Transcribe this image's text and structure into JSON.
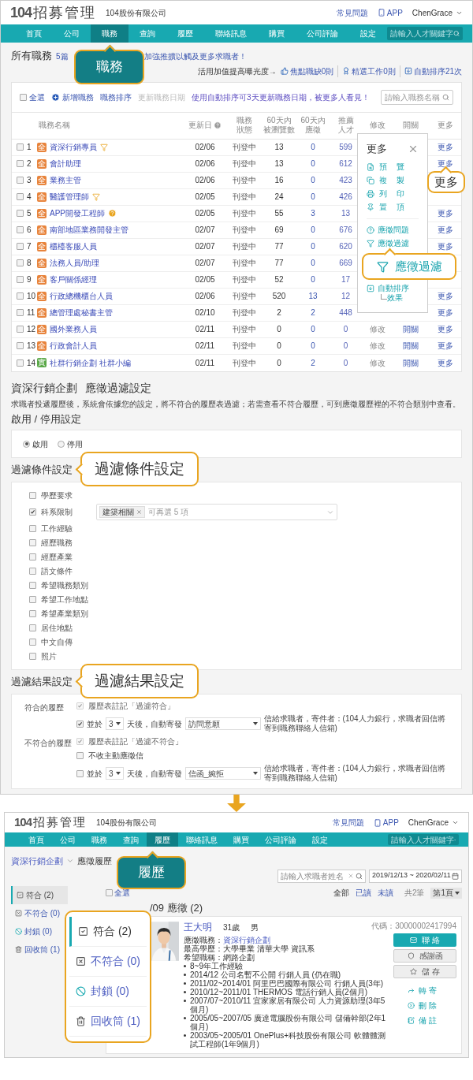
{
  "top": {
    "header": {
      "logo_digits": "104",
      "logo_text": "招募管理",
      "company": "104股份有限公司",
      "help": "常見問題",
      "app": "APP",
      "user": "ChenGrace"
    },
    "nav": {
      "items": [
        {
          "label": "首頁",
          "selected": false
        },
        {
          "label": "公司",
          "selected": false
        },
        {
          "label": "職務",
          "selected": true
        },
        {
          "label": "查詢",
          "selected": false
        },
        {
          "label": "履歷",
          "selected": false
        },
        {
          "label": "聯絡訊息",
          "selected": false
        },
        {
          "label": "購買",
          "selected": false
        },
        {
          "label": "公司評論",
          "selected": false
        },
        {
          "label": "設定",
          "selected": false
        }
      ],
      "search_placeholder": "請輸入人才關鍵字"
    },
    "callout": "職務",
    "title": "所有職務",
    "notice_start": "5篇",
    "notice_end": "加強推擴以觸及更多求職者！",
    "promo": {
      "label": "活用加值提高曝光度→",
      "items": [
        "焦點職缺0則",
        "精選工作0則",
        "自動排序21次"
      ]
    },
    "toolbar": {
      "select_all": "全選",
      "select_all_checked": false,
      "actions": [
        {
          "label": "新增職務",
          "disabled": false
        },
        {
          "label": "職務排序",
          "disabled": false
        },
        {
          "label": "更新職務日期",
          "disabled": true
        }
      ],
      "tip": "使用自動排序可3天更新職務日期，被更多人看見！",
      "search_placeholder": "請輸入職務名稱"
    },
    "columns": [
      "職務名稱",
      "更新日",
      "職務狀態",
      "60天內被瀏覽數",
      "60天內應徵",
      "推薦人才",
      "修改",
      "開關",
      "更多"
    ],
    "rows": [
      {
        "checked": false,
        "no": "1",
        "badge": "全",
        "color": "#e8843c",
        "name": "資深行銷專員",
        "filter": true,
        "questions": false,
        "date": "02/06",
        "status": "刊登中",
        "views": "13",
        "applies": "0",
        "talents": "599",
        "more": "更多"
      },
      {
        "checked": false,
        "no": "2",
        "badge": "全",
        "color": "#e8843c",
        "name": "會計助理",
        "filter": false,
        "questions": false,
        "date": "02/06",
        "status": "刊登中",
        "views": "13",
        "applies": "0",
        "talents": "612",
        "more": "更多"
      },
      {
        "checked": false,
        "no": "3",
        "badge": "全",
        "color": "#e8843c",
        "name": "業務主管",
        "filter": false,
        "questions": false,
        "date": "02/06",
        "status": "刊登中",
        "views": "16",
        "applies": "0",
        "talents": "423"
      },
      {
        "checked": false,
        "no": "4",
        "badge": "全",
        "color": "#e8843c",
        "name": "醫護管理師",
        "filter": true,
        "questions": false,
        "date": "02/05",
        "status": "刊登中",
        "views": "24",
        "applies": "0",
        "talents": "426"
      },
      {
        "checked": false,
        "no": "5",
        "badge": "全",
        "color": "#e8843c",
        "name": "APP開發工程師",
        "filter": false,
        "questions": true,
        "date": "02/05",
        "status": "刊登中",
        "views": "55",
        "applies": "3",
        "talents": "13",
        "more": "更多"
      },
      {
        "checked": false,
        "no": "6",
        "badge": "全",
        "color": "#e8843c",
        "name": "南部地區業務開發主管",
        "filter": false,
        "questions": false,
        "date": "02/07",
        "status": "刊登中",
        "views": "69",
        "applies": "0",
        "talents": "676",
        "more": "更多"
      },
      {
        "checked": false,
        "no": "7",
        "badge": "全",
        "color": "#e8843c",
        "name": "櫃檯客服人員",
        "filter": false,
        "questions": false,
        "date": "02/07",
        "status": "刊登中",
        "views": "77",
        "applies": "0",
        "talents": "620",
        "more": "更多"
      },
      {
        "checked": false,
        "no": "8",
        "badge": "全",
        "color": "#e8843c",
        "name": "法務人員/助理",
        "filter": false,
        "questions": false,
        "date": "02/07",
        "status": "刊登中",
        "views": "77",
        "applies": "0",
        "talents": "669"
      },
      {
        "checked": false,
        "no": "9",
        "badge": "全",
        "color": "#e8843c",
        "name": "客戶關係經理",
        "filter": false,
        "questions": false,
        "date": "02/05",
        "status": "刊登中",
        "views": "52",
        "applies": "0",
        "talents": "17"
      },
      {
        "checked": false,
        "no": "10",
        "badge": "全",
        "color": "#e8843c",
        "name": "行政總機櫃台人員",
        "filter": false,
        "questions": false,
        "date": "02/06",
        "status": "刊登中",
        "views": "520",
        "applies": "13",
        "talents": "12",
        "more": "更多"
      },
      {
        "checked": false,
        "no": "11",
        "badge": "全",
        "color": "#e8843c",
        "name": "總管理處秘書主管",
        "filter": false,
        "questions": false,
        "date": "02/10",
        "status": "刊登中",
        "views": "2",
        "applies": "2",
        "talents": "448",
        "more": "更多"
      },
      {
        "checked": false,
        "no": "12",
        "badge": "全",
        "color": "#e8843c",
        "name": "國外業務人員",
        "filter": false,
        "questions": false,
        "date": "02/11",
        "status": "刊登中",
        "views": "0",
        "applies": "0",
        "talents": "0",
        "edit": "修改",
        "toggle": "開關",
        "more": "更多"
      },
      {
        "checked": false,
        "no": "13",
        "badge": "全",
        "color": "#e8843c",
        "name": "行政會計人員",
        "filter": false,
        "questions": false,
        "date": "02/11",
        "status": "刊登中",
        "views": "0",
        "applies": "0",
        "talents": "0",
        "edit": "修改",
        "toggle": "開關",
        "more": "更多"
      },
      {
        "checked": false,
        "no": "14",
        "badge": "實",
        "color": "#5aa848",
        "name": "社群行銷企劃 社群小編",
        "filter": false,
        "questions": false,
        "date": "02/11",
        "status": "刊登中",
        "views": "0",
        "applies": "2",
        "talents": "0",
        "edit": "修改",
        "toggle": "開關",
        "more": "更多"
      }
    ],
    "more_menu": {
      "title": "更多",
      "items": [
        "預覽",
        "複製",
        "列印",
        "置頂"
      ],
      "items2": [
        "應徵問題",
        "應徵過濾"
      ],
      "auto_sort": "自動排序",
      "auto_sort_sub": "效果"
    },
    "more_callout": "更多",
    "filter_callout": "應徵過濾"
  },
  "filter_page": {
    "job": "資深行銷企劃",
    "title": "應徵過濾設定",
    "description": "求職者投遞履歷後，系統會依據您的設定，將不符合的履歷表過濾；若需查看不符合履歷，可到應徵履歷裡的不符合類別中查看。",
    "enable_title": "啟用 / 停用設定",
    "radios": [
      {
        "label": "啟用",
        "selected": true
      },
      {
        "label": "停用",
        "selected": false
      }
    ],
    "conditions_title": "過濾條件設定",
    "conditions_callout": "過濾條件設定",
    "conditions": [
      {
        "label": "學歷要求",
        "checked": false
      },
      {
        "label": "科系限制",
        "checked": true,
        "tags": [
          "建築相關"
        ],
        "placeholder": "可再選 5 項"
      },
      {
        "label": "工作經驗",
        "checked": false
      },
      {
        "label": "經歷職務",
        "checked": false
      },
      {
        "label": "經歷產業",
        "checked": false
      },
      {
        "label": "語文條件",
        "checked": false
      },
      {
        "label": "希望職務類別",
        "checked": false
      },
      {
        "label": "希望工作地點",
        "checked": false
      },
      {
        "label": "希望產業類別",
        "checked": false
      },
      {
        "label": "居住地點",
        "checked": false
      },
      {
        "label": "中文自傳",
        "checked": false
      },
      {
        "label": "照片",
        "checked": false
      }
    ],
    "results_title": "過濾結果設定",
    "results_callout": "過濾結果設定",
    "results": [
      {
        "label": "符合的履歷",
        "options": [
          {
            "kind": "note",
            "checked": true,
            "disabled": true,
            "label": "履歷表註記「過濾符合」"
          },
          {
            "kind": "mail",
            "checked": true,
            "disabled": false,
            "before": "並於",
            "days": "3",
            "middle": "天後，自動寄發",
            "template": "訪問意願",
            "after": "信給求職者，寄件者：(104人力銀行，求職者回信將寄到職務聯絡人信箱)"
          }
        ]
      },
      {
        "label": "不符合的履歷",
        "options": [
          {
            "kind": "note",
            "checked": true,
            "disabled": true,
            "label": "履歷表註記「過濾不符合」"
          },
          {
            "kind": "note",
            "checked": false,
            "disabled": false,
            "label": "不收主動應徵信"
          },
          {
            "kind": "mail",
            "checked": false,
            "disabled": false,
            "before": "並於",
            "days": "3",
            "middle": "天後，自動寄發",
            "template": "信函_婉拒",
            "after": "信給求職者，寄件者：(104人力銀行，求職者回信將寄到職務聯絡人信箱)"
          }
        ]
      }
    ]
  },
  "bottom": {
    "header": {
      "logo_digits": "104",
      "logo_text": "招募管理",
      "company": "104股份有限公司",
      "help": "常見問題",
      "app": "APP",
      "user": "ChenGrace"
    },
    "nav": {
      "items": [
        {
          "label": "首頁",
          "selected": false
        },
        {
          "label": "公司",
          "selected": false
        },
        {
          "label": "職務",
          "selected": false
        },
        {
          "label": "查詢",
          "selected": false
        },
        {
          "label": "履歷",
          "selected": true
        },
        {
          "label": "聯絡訊息",
          "selected": false
        },
        {
          "label": "購買",
          "selected": false
        },
        {
          "label": "公司評論",
          "selected": false
        },
        {
          "label": "設定",
          "selected": false
        }
      ],
      "search_placeholder": "請輸入人才關鍵字"
    },
    "callout": "履歷",
    "breadcrumb_parent": "資深行銷企劃",
    "breadcrumb_current": "應徵履歷",
    "search_placeholder": "請輸入求職者姓名",
    "date_range": "2019/12/13 ~ 2020/02/11",
    "sidebar": [
      {
        "label": "符合 (2)",
        "selected": true
      },
      {
        "label": "不符合 (0)",
        "selected": false
      },
      {
        "label": "封鎖 (0)",
        "selected": false
      },
      {
        "label": "回收筒 (1)",
        "selected": false
      }
    ],
    "zoom_panel": [
      {
        "label": "符合 (2)",
        "selected": true
      },
      {
        "label": "不符合 (0)",
        "selected": false
      },
      {
        "label": "封鎖 (0)",
        "selected": false
      },
      {
        "label": "回收筒 (1)",
        "selected": false
      }
    ],
    "select_all": "全選",
    "select_all_checked": false,
    "views": [
      {
        "label": "全部",
        "selected": true
      },
      {
        "label": "已讀",
        "selected": false
      },
      {
        "label": "未讀",
        "selected": false
      }
    ],
    "total": "共2筆",
    "page": "第1頁",
    "group_title": "/09 應徵 (2)",
    "resume": {
      "name": "王大明",
      "age": "31歲",
      "gender": "男",
      "code": "代碼：30000002417994",
      "fields": [
        {
          "label": "應徵職務：",
          "value": "資深行銷企劃",
          "link": true
        },
        {
          "label": "最高學歷：",
          "value": "大學畢業 清華大學 資訊系",
          "link": false
        },
        {
          "label": "希望職稱：",
          "value": "網路企劃",
          "link": false
        }
      ],
      "experience": [
        "8~9年工作經驗",
        "2014/12 公司名暫不公開 行銷人員 (仍在職)",
        "2011/02~2014/01 阿里巴巴國際有限公司 行銷人員(3年)",
        "2010/12~2011/01 THERMOS 電話行銷人員(2個月)",
        "2007/07~2010/11 宜家家居有限公司 人力資源助理(3年5個月)",
        "2005/05~2007/05 廣達電腦股份有限公司 儲備幹部(2年1個月)",
        "2003/05~2005/01 OnePlus+科技股份有限公司 軟體體測試工程師(1年9個月)"
      ],
      "buttons": [
        {
          "label": "聯 絡",
          "kind": "primary"
        },
        {
          "label": "感謝函",
          "kind": "secondary"
        },
        {
          "label": "儲 存",
          "kind": "secondary"
        }
      ],
      "links": [
        "轉 寄",
        "刪 除",
        "備 註"
      ]
    }
  }
}
